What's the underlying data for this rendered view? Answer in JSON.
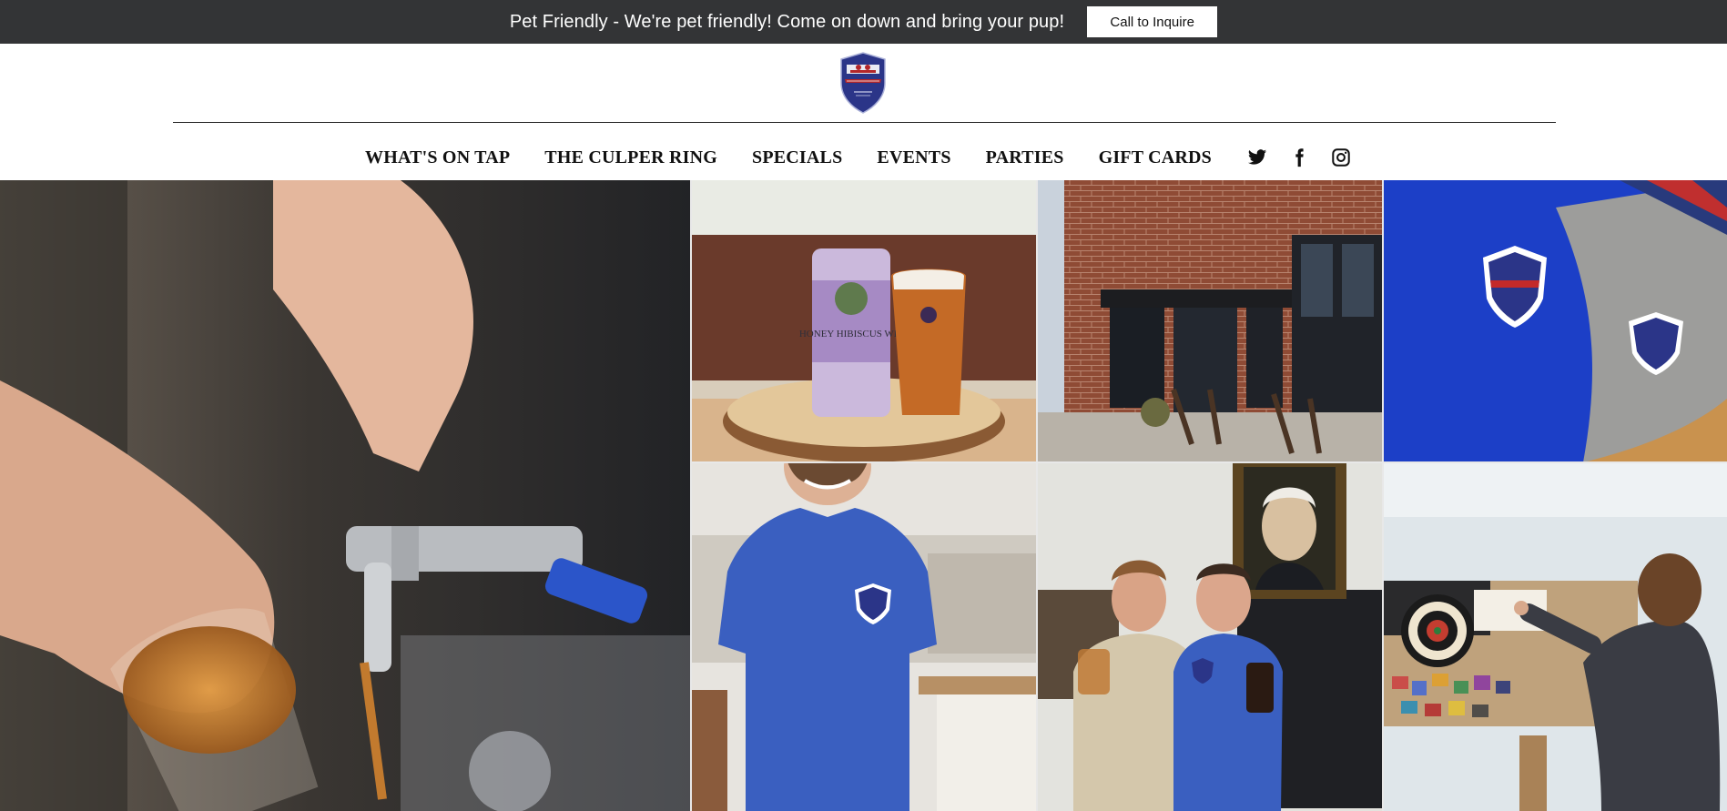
{
  "announcement": {
    "text": "Pet Friendly - We're pet friendly! Come on down and bring your pup!",
    "button_label": "Call to Inquire"
  },
  "brand": {
    "logo_icon": "brewhouse-shield-logo-icon",
    "colors": {
      "topbar": "#333436",
      "shield_navy": "#2b3588",
      "shield_red": "#b3262a"
    }
  },
  "nav": {
    "items": [
      {
        "label": "WHAT'S ON TAP"
      },
      {
        "label": "THE CULPER RING"
      },
      {
        "label": "SPECIALS"
      },
      {
        "label": "EVENTS"
      },
      {
        "label": "PARTIES"
      },
      {
        "label": "GIFT CARDS"
      }
    ],
    "social": [
      "twitter-icon",
      "facebook-icon",
      "instagram-icon"
    ]
  },
  "gallery": {
    "can_label": "HONEY HIBISCUS WIT",
    "photos": [
      "bartender pouring beer from tap",
      "can and glass on wood slice",
      "brick brewhouse exterior",
      "blue beanie with shield logo",
      "staff in blue t-shirt",
      "two men with beers under portrait",
      "dartboard and wall of coasters"
    ]
  }
}
